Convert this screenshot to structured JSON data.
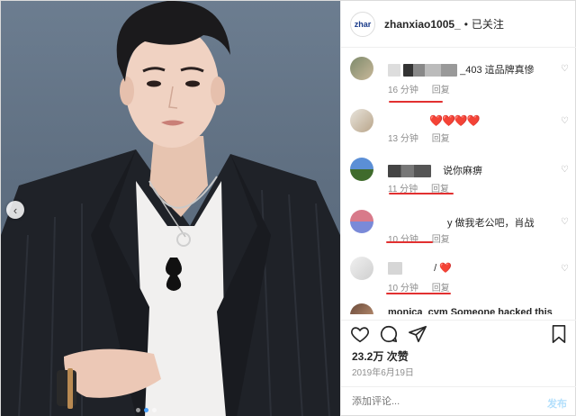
{
  "post": {
    "username": "zhanxiao1005_",
    "separator": "•",
    "follow_status": "已关注",
    "avatar_text": "zhar",
    "likes": "23.2万 次赞",
    "date": "2019年6月19日",
    "comment_placeholder": "添加评论...",
    "post_label": "发布"
  },
  "comments": [
    {
      "text": "_403 這品牌真慘",
      "time": "16 分钟",
      "reply": "回复"
    },
    {
      "text": "❤️❤️❤️❤️",
      "time": "13 分钟",
      "reply": "回复"
    },
    {
      "text": "说你麻痹",
      "time": "11 分钟",
      "reply": "回复"
    },
    {
      "text": "y 做我老公吧，肖战",
      "time": "10 分钟",
      "reply": "回复"
    },
    {
      "text": "/ ❤️",
      "time": "10 分钟",
      "reply": "回复"
    },
    {
      "text": "monica_cym Someone hacked this",
      "time": "",
      "reply": ""
    }
  ],
  "icons": {
    "like": "heart-icon",
    "comment": "comment-icon",
    "share": "send-icon",
    "save": "bookmark-icon",
    "prev": "chevron-left-icon"
  },
  "colors": {
    "annotation": "#e23030",
    "link_disabled": "#b2dffc",
    "muted": "#8e8e8e"
  },
  "carousel": {
    "current": 1,
    "total": 3
  }
}
